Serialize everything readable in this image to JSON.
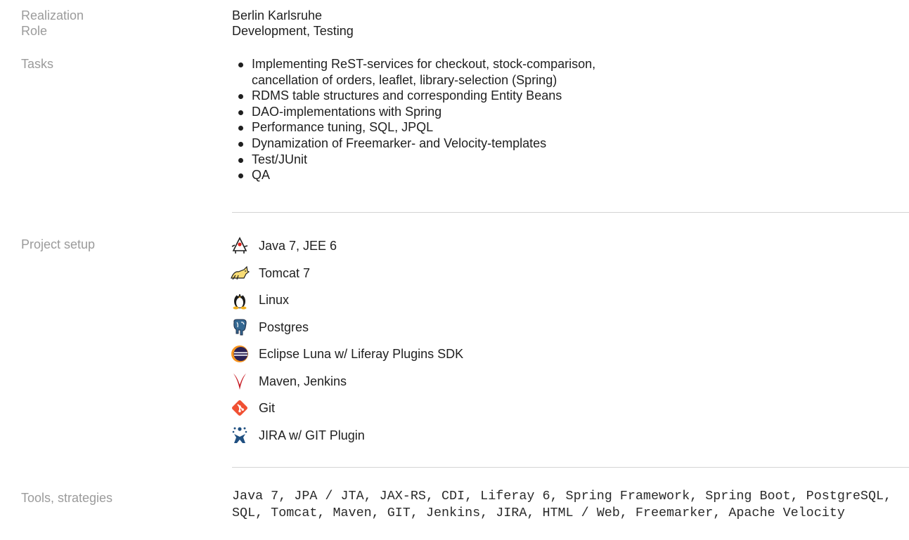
{
  "realization": {
    "label": "Realization",
    "value": "Berlin Karlsruhe"
  },
  "role": {
    "label": "Role",
    "value": "Development, Testing"
  },
  "tasks": {
    "label": "Tasks",
    "items": [
      "Implementing ReST-services for checkout, stock-comparison,",
      "RDMS table structures and corresponding Entity Beans",
      "DAO-implementations with Spring",
      "Performance tuning, SQL, JPQL",
      "Dynamization of Freemarker- and Velocity-templates",
      "Test/JUnit",
      "QA"
    ],
    "first_item_line2": "cancellation of orders, leaflet, library-selection (Spring)"
  },
  "project_setup": {
    "label": "Project setup",
    "items": [
      {
        "text": "Java 7, JEE 6",
        "icon": "java-duke-icon"
      },
      {
        "text": "Tomcat 7",
        "icon": "tomcat-icon"
      },
      {
        "text": "Linux",
        "icon": "tux-penguin-icon"
      },
      {
        "text": "Postgres",
        "icon": "postgres-elephant-icon"
      },
      {
        "text": "Eclipse Luna w/ Liferay Plugins SDK",
        "icon": "eclipse-icon"
      },
      {
        "text": "Maven, Jenkins",
        "icon": "maven-feather-icon"
      },
      {
        "text": "Git",
        "icon": "git-icon"
      },
      {
        "text": "JIRA w/ GIT Plugin",
        "icon": "jira-icon"
      }
    ]
  },
  "tools": {
    "label": "Tools, strategies",
    "value": "Java 7, JPA / JTA, JAX-RS, CDI, Liferay 6, Spring Framework, Spring Boot, PostgreSQL, SQL, Tomcat, Maven, GIT, Jenkins, JIRA, HTML / Web, Freemarker, Apache Velocity"
  },
  "colors": {
    "label": "#9b9b9b",
    "text": "#1f1f1f",
    "divider": "#d4d4d4",
    "git": "#f05033",
    "maven": "#c71a22",
    "eclipse": "#2c2255",
    "jira": "#205081",
    "postgres": "#336791"
  }
}
